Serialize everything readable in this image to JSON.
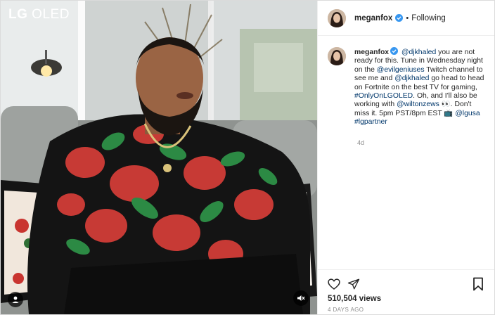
{
  "media": {
    "brand_bold": "LG",
    "brand_rest": "OLED",
    "tag_icon": "user-tag-icon",
    "volume_icon": "volume-muted-icon"
  },
  "header": {
    "username": "meganfox",
    "separator": "•",
    "follow_status": "Following"
  },
  "caption": {
    "author": "meganfox",
    "segments": [
      {
        "type": "mention",
        "text": "@djkhaled"
      },
      {
        "type": "text",
        "text": " you are not ready for this. Tune in Wednesday night on the "
      },
      {
        "type": "mention",
        "text": "@evilgeniuses"
      },
      {
        "type": "text",
        "text": " Twitch channel to see me and "
      },
      {
        "type": "mention",
        "text": "@djkhaled"
      },
      {
        "type": "text",
        "text": " go head to head on Fortnite on the best TV for gaming, "
      },
      {
        "type": "hashtag",
        "text": "#OnlyOnLGOLED"
      },
      {
        "type": "text",
        "text": ". Oh, and I'll also be working with "
      },
      {
        "type": "mention",
        "text": "@wiltonzews"
      },
      {
        "type": "text",
        "text": " 👀. Don't miss it. 5pm PST/8pm EST 📺 "
      },
      {
        "type": "mention",
        "text": "@lgusa"
      },
      {
        "type": "text",
        "text": " "
      },
      {
        "type": "hashtag",
        "text": "#lgpartner"
      }
    ],
    "age": "4d"
  },
  "footer": {
    "views": "510,504 views",
    "date": "4 DAYS AGO"
  },
  "colors": {
    "link": "#00376b",
    "verified": "#3897f0",
    "muted": "#8e8e8e"
  }
}
